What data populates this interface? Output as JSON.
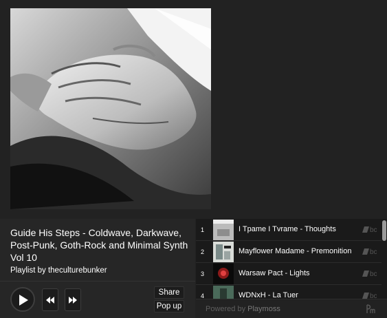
{
  "player": {
    "title": "Guide His Steps - Coldwave, Darkwave, Post-Punk, Goth-Rock and Minimal Synth Vol 10",
    "byline": "Playlist by theculturebunker",
    "share_label": "Share",
    "popup_label": "Pop up"
  },
  "playlist": {
    "tracks": [
      {
        "num": "1",
        "title": "I Tpame I Tvrame - Thoughts",
        "badge": "bc"
      },
      {
        "num": "2",
        "title": "Mayflower Madame - Premonition",
        "badge": "bc"
      },
      {
        "num": "3",
        "title": "Warsaw Pact - Lights",
        "badge": "bc"
      },
      {
        "num": "4",
        "title": "WDNxH - La Tuer",
        "badge": "bc"
      }
    ],
    "scroll_position": 0
  },
  "footer": {
    "powered_by": "Powered by",
    "brand": "Playmoss"
  },
  "icons": {
    "play": "play-icon",
    "prev": "rewind-icon",
    "next": "fast-forward-icon",
    "bandcamp": "bandcamp-icon",
    "playmoss": "playmoss-logo-icon"
  },
  "colors": {
    "background": "#222222",
    "playlist_bg": "#1a1a1a",
    "text": "#ffffff",
    "muted": "#5e5e5e"
  }
}
